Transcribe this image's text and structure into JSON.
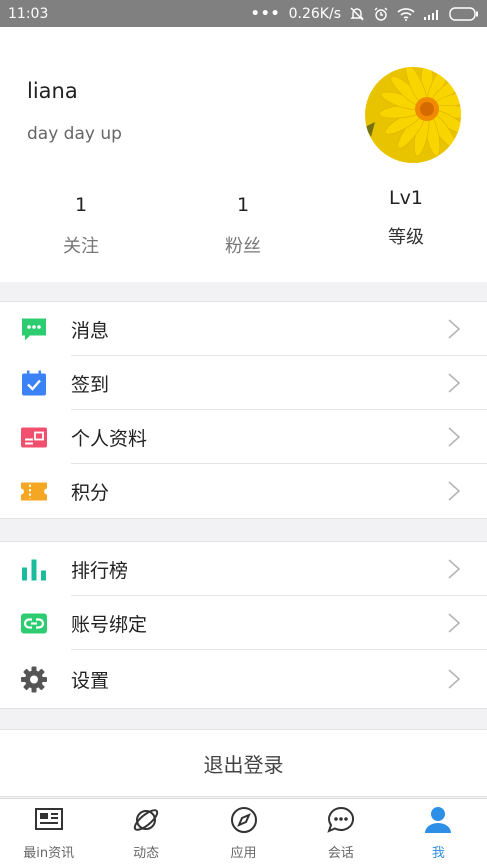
{
  "status_bar": {
    "time": "11:03",
    "network_speed": "0.26K/s"
  },
  "profile": {
    "username": "liana",
    "motto": "day day up",
    "stats": [
      {
        "value": "1",
        "label": "关注"
      },
      {
        "value": "1",
        "label": "粉丝"
      },
      {
        "value": "Lv1",
        "label": "等级"
      }
    ]
  },
  "menu_group_1": [
    {
      "label": "消息",
      "icon": "message-icon",
      "color": "#2ecc71"
    },
    {
      "label": "签到",
      "icon": "checkin-icon",
      "color": "#3b82f6"
    },
    {
      "label": "个人资料",
      "icon": "profile-card-icon",
      "color": "#f0506e"
    },
    {
      "label": "积分",
      "icon": "ticket-icon",
      "color": "#f5a623"
    }
  ],
  "menu_group_2": [
    {
      "label": "排行榜",
      "icon": "bar-chart-icon",
      "color": "#1abc9c"
    },
    {
      "label": "账号绑定",
      "icon": "link-icon",
      "color": "#2ecc71"
    },
    {
      "label": "设置",
      "icon": "gear-icon",
      "color": "#555555"
    }
  ],
  "logout_label": "退出登录",
  "tabs": [
    {
      "label": "最in资讯",
      "icon": "news-icon",
      "active": false
    },
    {
      "label": "动态",
      "icon": "planet-icon",
      "active": false
    },
    {
      "label": "应用",
      "icon": "compass-icon",
      "active": false
    },
    {
      "label": "会话",
      "icon": "chat-icon",
      "active": false
    },
    {
      "label": "我",
      "icon": "user-icon",
      "active": true
    }
  ],
  "colors": {
    "accent": "#2d8fe5",
    "status_bar": "#808080"
  }
}
